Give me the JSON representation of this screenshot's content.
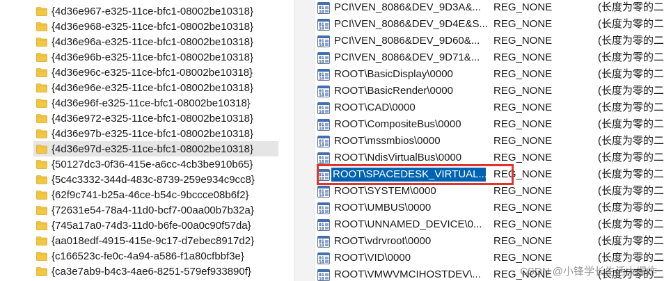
{
  "tree": {
    "items": [
      {
        "label": "{4d36e967-e325-11ce-bfc1-08002be10318}",
        "selected": false
      },
      {
        "label": "{4d36e968-e325-11ce-bfc1-08002be10318}",
        "selected": false
      },
      {
        "label": "{4d36e96a-e325-11ce-bfc1-08002be10318}",
        "selected": false
      },
      {
        "label": "{4d36e96b-e325-11ce-bfc1-08002be10318}",
        "selected": false
      },
      {
        "label": "{4d36e96c-e325-11ce-bfc1-08002be10318}",
        "selected": false
      },
      {
        "label": "{4d36e96e-e325-11ce-bfc1-08002be10318}",
        "selected": false
      },
      {
        "label": "{4d36e96f-e325-11ce-bfc1-08002be10318}",
        "selected": false
      },
      {
        "label": "{4d36e972-e325-11ce-bfc1-08002be10318}",
        "selected": false
      },
      {
        "label": "{4d36e97b-e325-11ce-bfc1-08002be10318}",
        "selected": false
      },
      {
        "label": "{4d36e97d-e325-11ce-bfc1-08002be10318}",
        "selected": true
      },
      {
        "label": "{50127dc3-0f36-415e-a6cc-4cb3be910b65}",
        "selected": false
      },
      {
        "label": "{5c4c3332-344d-483c-8739-259e934c9cc8}",
        "selected": false
      },
      {
        "label": "{62f9c741-b25a-46ce-b54c-9bccce08b6f2}",
        "selected": false
      },
      {
        "label": "{72631e54-78a4-11d0-bcf7-00aa00b7b32a}",
        "selected": false
      },
      {
        "label": "{745a17a0-74d3-11d0-b6fe-00a0c90f57da}",
        "selected": false
      },
      {
        "label": "{aa018edf-4915-415e-9c17-d7ebec8917d2}",
        "selected": false
      },
      {
        "label": "{c166523c-fe0c-4a94-a586-f1a80cfbbf3e}",
        "selected": false
      },
      {
        "label": "{ca3e7ab9-b4c3-4ae6-8251-579ef933890f}",
        "selected": false
      }
    ]
  },
  "values": {
    "rows": [
      {
        "name": "PCI\\VEN_8086&DEV_9D3A&...",
        "type": "REG_NONE",
        "data": "(长度为零的二",
        "selected": false
      },
      {
        "name": "PCI\\VEN_8086&DEV_9D4E&S...",
        "type": "REG_NONE",
        "data": "(长度为零的二",
        "selected": false
      },
      {
        "name": "PCI\\VEN_8086&DEV_9D60&...",
        "type": "REG_NONE",
        "data": "(长度为零的二",
        "selected": false
      },
      {
        "name": "PCI\\VEN_8086&DEV_9D71&...",
        "type": "REG_NONE",
        "data": "(长度为零的二",
        "selected": false
      },
      {
        "name": "ROOT\\BasicDisplay\\0000",
        "type": "REG_NONE",
        "data": "(长度为零的二",
        "selected": false
      },
      {
        "name": "ROOT\\BasicRender\\0000",
        "type": "REG_NONE",
        "data": "(长度为零的二",
        "selected": false
      },
      {
        "name": "ROOT\\CAD\\0000",
        "type": "REG_NONE",
        "data": "(长度为零的二",
        "selected": false
      },
      {
        "name": "ROOT\\CompositeBus\\0000",
        "type": "REG_NONE",
        "data": "(长度为零的二",
        "selected": false
      },
      {
        "name": "ROOT\\mssmbios\\0000",
        "type": "REG_NONE",
        "data": "(长度为零的二",
        "selected": false
      },
      {
        "name": "ROOT\\NdisVirtualBus\\0000",
        "type": "REG_NONE",
        "data": "(长度为零的二",
        "selected": false
      },
      {
        "name": "ROOT\\SPACEDESK_VIRTUAL...",
        "type": "REG_NONE",
        "data": "(长度为零的二",
        "selected": true
      },
      {
        "name": "ROOT\\SYSTEM\\0000",
        "type": "REG_NONE",
        "data": "(长度为零的二",
        "selected": false
      },
      {
        "name": "ROOT\\UMBUS\\0000",
        "type": "REG_NONE",
        "data": "(长度为零的二",
        "selected": false
      },
      {
        "name": "ROOT\\UNNAMED_DEVICE\\0...",
        "type": "REG_NONE",
        "data": "(长度为零的二",
        "selected": false
      },
      {
        "name": "ROOT\\vdrvroot\\0000",
        "type": "REG_NONE",
        "data": "(长度为零的二",
        "selected": false
      },
      {
        "name": "ROOT\\VID\\0000",
        "type": "REG_NONE",
        "data": "(长度为零的二",
        "selected": false
      },
      {
        "name": "ROOT\\VMWVMCIHOSTDEV\\...",
        "type": "REG_NONE",
        "data": "(长度为零的二",
        "selected": false
      }
    ]
  },
  "watermark": "CSDN @小锋学长生活大爆炸",
  "colors": {
    "selection_blue": "#0063b1",
    "tree_selected_bg": "#e5e5e5",
    "folder_yellow": "#f2c744",
    "annotation_red": "#e0332b"
  },
  "icons": {
    "tree_item": "folder-icon",
    "value_item": "binary-value-icon"
  }
}
